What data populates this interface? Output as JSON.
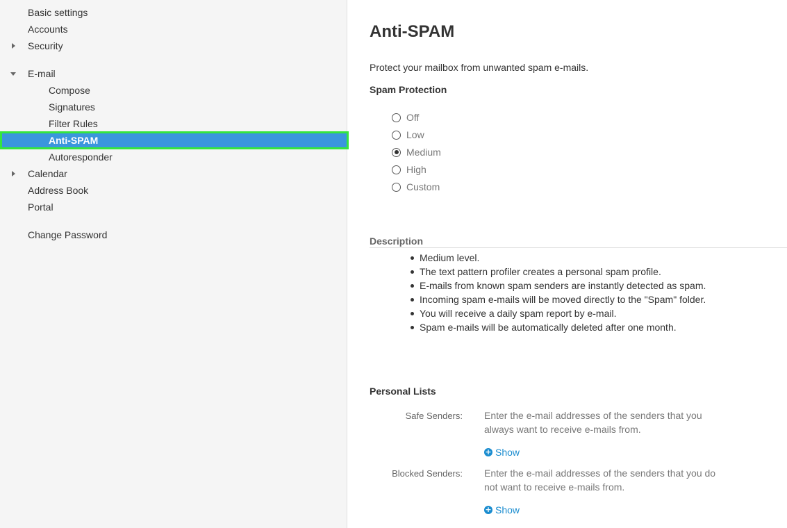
{
  "sidebar": {
    "items": [
      {
        "label": "Basic settings"
      },
      {
        "label": "Accounts"
      },
      {
        "label": "Security"
      },
      {
        "label": "E-mail"
      },
      {
        "label": "Compose"
      },
      {
        "label": "Signatures"
      },
      {
        "label": "Filter Rules"
      },
      {
        "label": "Anti-SPAM"
      },
      {
        "label": "Autoresponder"
      },
      {
        "label": "Calendar"
      },
      {
        "label": "Address Book"
      },
      {
        "label": "Portal"
      },
      {
        "label": "Change Password"
      }
    ],
    "active": "Anti-SPAM",
    "colors": {
      "active_bg": "#3a96dd",
      "highlight_border": "#35e53f"
    }
  },
  "main": {
    "title": "Anti-SPAM",
    "intro": "Protect your mailbox from unwanted spam e-mails.",
    "spam_protection": {
      "heading": "Spam Protection",
      "options": [
        "Off",
        "Low",
        "Medium",
        "High",
        "Custom"
      ],
      "selected": "Medium"
    },
    "description": {
      "heading": "Description",
      "items": [
        "Medium level.",
        "The text pattern profiler creates a personal spam profile.",
        "E-mails from known spam senders are instantly detected as spam.",
        "Incoming spam e-mails will be moved directly to the \"Spam\" folder.",
        "You will receive a daily spam report by e-mail.",
        "Spam e-mails will be automatically deleted after one month."
      ]
    },
    "personal_lists": {
      "heading": "Personal Lists",
      "safe": {
        "label": "Safe Senders:",
        "text": "Enter the e-mail addresses of the senders that you always want to receive e-mails from.",
        "show": "Show"
      },
      "blocked": {
        "label": "Blocked Senders:",
        "text": "Enter the e-mail addresses of the senders that you do not want to receive e-mails from.",
        "show": "Show"
      }
    },
    "colors": {
      "link": "#1a8ccf"
    }
  }
}
